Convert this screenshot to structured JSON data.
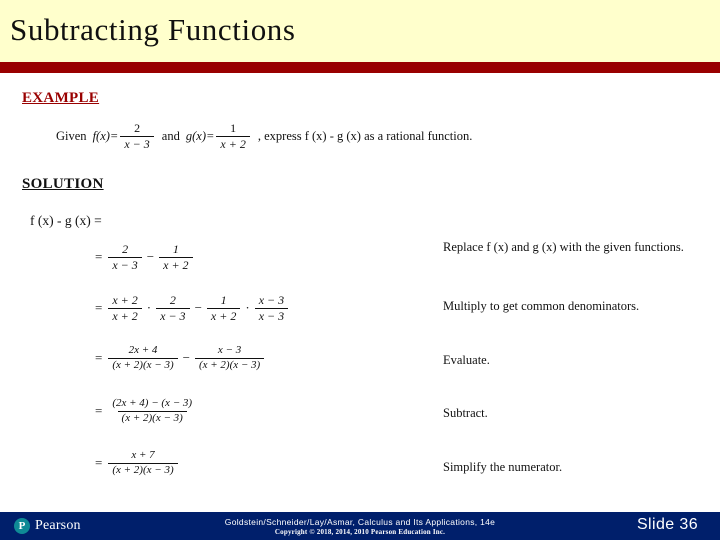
{
  "slide": {
    "title": "Subtracting Functions",
    "header_bg": "#ffffcc",
    "rule_color": "#990000",
    "footer_bg": "#001f6b"
  },
  "example": {
    "heading": "EXAMPLE",
    "given_word": "Given",
    "and_word": "and",
    "f_name": "f",
    "f_arg": "(x)=",
    "f_num": "2",
    "f_den": "x − 3",
    "g_name": "g",
    "g_arg": "(x)=",
    "g_num": "1",
    "g_den": "x + 2",
    "tail": ", express f (x) - g (x) as a rational function."
  },
  "solution": {
    "heading": "SOLUTION",
    "lhs": "f (x) - g (x) =",
    "steps": [
      {
        "eq": "=",
        "parts": [
          {
            "kind": "frac",
            "num": "2",
            "den": "x − 3"
          },
          {
            "kind": "op",
            "text": "−"
          },
          {
            "kind": "frac",
            "num": "1",
            "den": "x + 2"
          }
        ]
      },
      {
        "eq": "=",
        "parts": [
          {
            "kind": "frac",
            "num": "x + 2",
            "den": "x + 2"
          },
          {
            "kind": "op",
            "text": "·"
          },
          {
            "kind": "frac",
            "num": "2",
            "den": "x − 3"
          },
          {
            "kind": "op",
            "text": "−"
          },
          {
            "kind": "frac",
            "num": "1",
            "den": "x + 2"
          },
          {
            "kind": "op",
            "text": "·"
          },
          {
            "kind": "frac",
            "num": "x − 3",
            "den": "x − 3"
          }
        ]
      },
      {
        "eq": "=",
        "parts": [
          {
            "kind": "frac",
            "num": "2x + 4",
            "den": "(x + 2)(x − 3)"
          },
          {
            "kind": "op",
            "text": "−"
          },
          {
            "kind": "frac",
            "num": "x − 3",
            "den": "(x + 2)(x − 3)"
          }
        ]
      },
      {
        "eq": "=",
        "parts": [
          {
            "kind": "frac",
            "num": "(2x + 4) − (x − 3)",
            "den": "(x + 2)(x − 3)"
          }
        ]
      },
      {
        "eq": "=",
        "parts": [
          {
            "kind": "frac",
            "num": "x + 7",
            "den": "(x + 2)(x − 3)"
          }
        ]
      }
    ],
    "notes": [
      "Replace f (x) and g (x) with the given functions.",
      "Multiply to get common denominators.",
      "Evaluate.",
      "Subtract.",
      "Simplify the numerator."
    ]
  },
  "footer": {
    "logo_letter": "P",
    "logo_word": "Pearson",
    "citation": "Goldstein/Schneider/Lay/Asmar, Calculus and Its Applications, 14e",
    "copyright": "Copyright © 2018, 2014, 2010 Pearson Education Inc.",
    "slide_number": "Slide 36"
  }
}
